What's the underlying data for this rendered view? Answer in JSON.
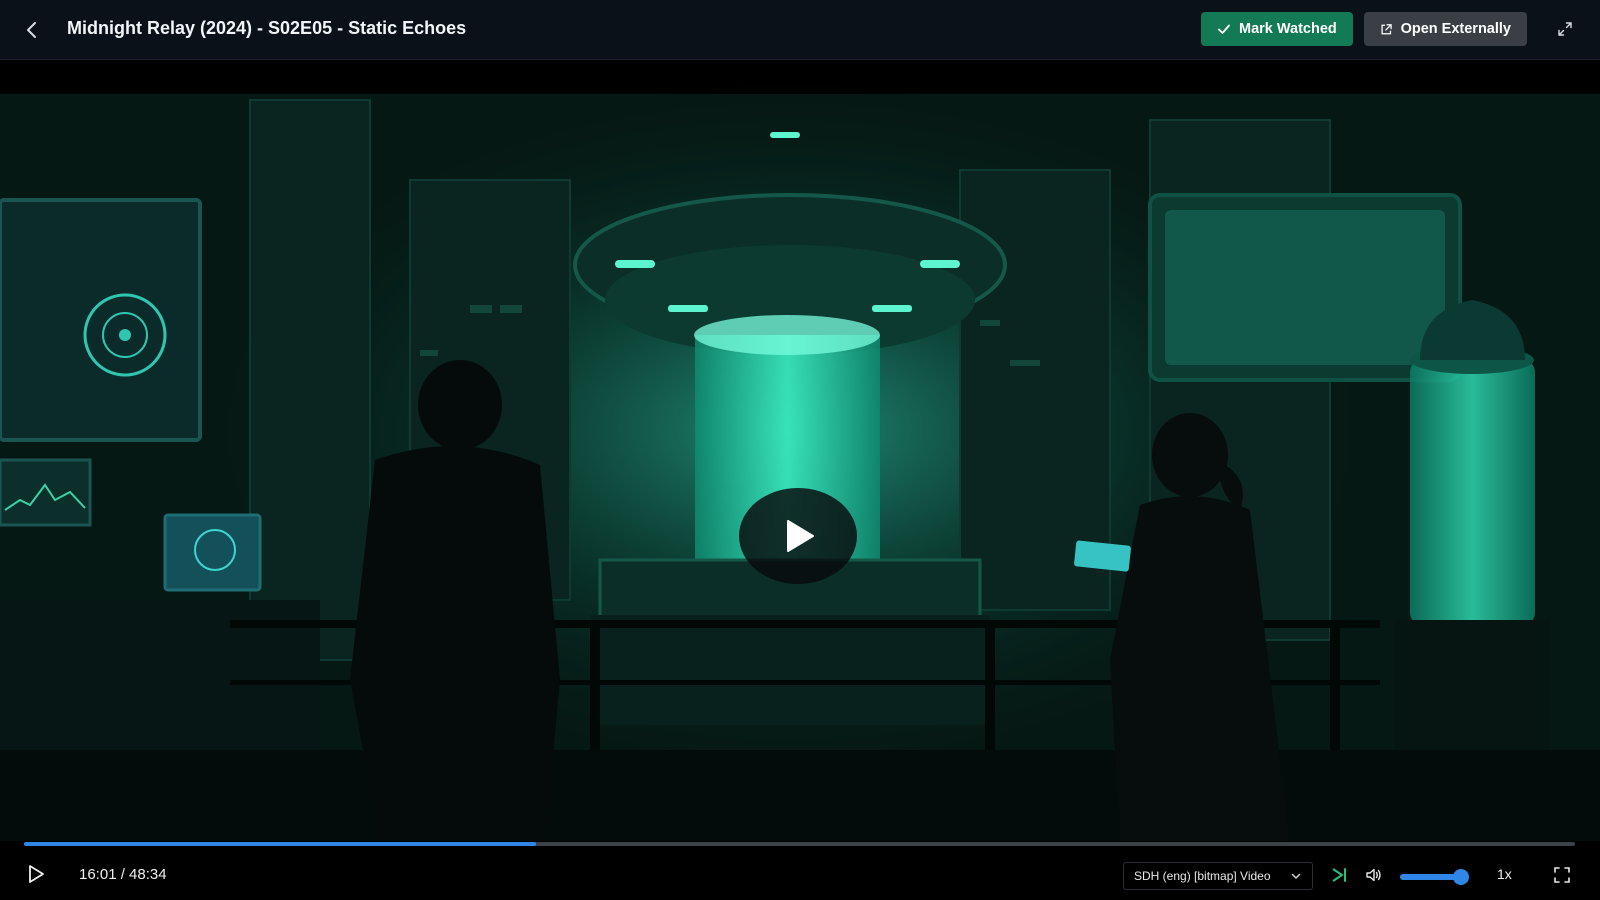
{
  "header": {
    "title": "Midnight Relay (2024) - S02E05 - Static Echoes",
    "mark_watched_label": "Mark Watched",
    "open_externally_label": "Open Externally"
  },
  "player": {
    "time_display": "16:01 / 48:34",
    "progress_fraction": 0.33,
    "subtitle_track": "SDH (eng) [bitmap] Video",
    "volume_fraction": 0.9,
    "speed": "1x",
    "state": "paused"
  },
  "colors": {
    "accent": "#2f86e6",
    "watched_button": "#127a55",
    "skip_icon": "#22c27a"
  },
  "icons": {
    "back": "chevron-left-icon",
    "mark_watched": "check-icon",
    "open_externally": "external-link-icon",
    "expand": "expand-icon",
    "play": "play-icon",
    "skip": "skip-next-icon",
    "volume": "volume-icon",
    "fullscreen": "fullscreen-icon"
  }
}
